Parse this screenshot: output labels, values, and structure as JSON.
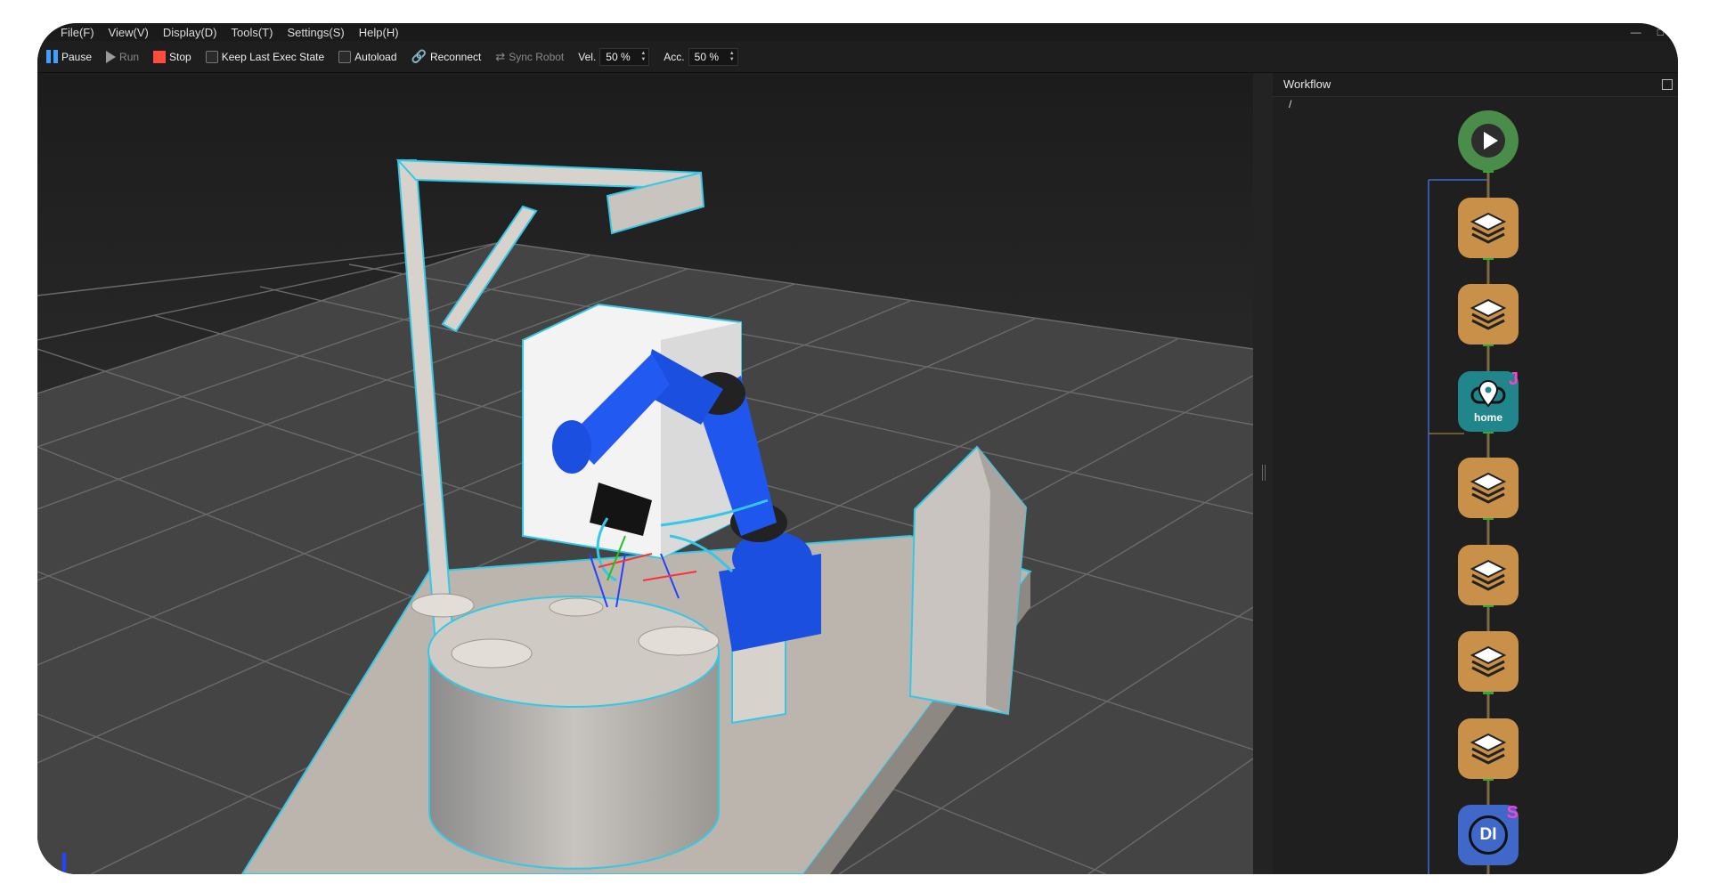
{
  "menu": {
    "items": [
      "File(F)",
      "View(V)",
      "Display(D)",
      "Tools(T)",
      "Settings(S)",
      "Help(H)"
    ]
  },
  "window": {
    "minimize": "—",
    "maximize": "□"
  },
  "toolbar": {
    "pause_label": "Pause",
    "run_label": "Run",
    "stop_label": "Stop",
    "keep_last_exec_state_label": "Keep Last Exec State",
    "autoload_label": "Autoload",
    "reconnect_label": "Reconnect",
    "sync_robot_label": "Sync Robot",
    "vel_label": "Vel.",
    "vel_value": "50 %",
    "acc_label": "Acc.",
    "acc_value": "50 %"
  },
  "workflow": {
    "title": "Workflow",
    "path": "/",
    "nodes": [
      {
        "type": "start",
        "icon": "play-icon"
      },
      {
        "type": "layer",
        "icon": "layers-icon"
      },
      {
        "type": "layer",
        "icon": "layers-icon"
      },
      {
        "type": "home",
        "icon": "location-pin-icon",
        "label": "home",
        "badge": "J"
      },
      {
        "type": "layer",
        "icon": "layers-icon"
      },
      {
        "type": "layer",
        "icon": "layers-icon"
      },
      {
        "type": "layer",
        "icon": "layers-icon"
      },
      {
        "type": "layer",
        "icon": "layers-icon"
      },
      {
        "type": "di",
        "icon": "di-icon",
        "label": "DI",
        "badge": "S"
      }
    ]
  },
  "colors": {
    "accent_blue": "#3fa0ff",
    "stop_red": "#ff4d3d",
    "node_layer": "#c89048",
    "node_start": "#4a8c4a",
    "node_home": "#20868c",
    "node_di": "#3f68c8",
    "badge_magenta": "#ff3fd0",
    "robot_blue": "#1a4fe0",
    "highlight_cyan": "#35c8e6"
  }
}
